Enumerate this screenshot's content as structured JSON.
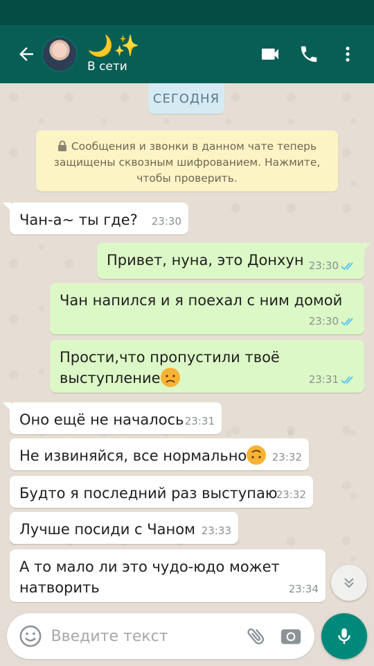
{
  "header": {
    "contact_name": "🌙✨",
    "status": "В сети"
  },
  "chat": {
    "date_label": "СЕГОДНЯ",
    "encryption_notice": "Сообщения и звонки в данном чате теперь защищены сквозным шифрованием. Нажмите, чтобы проверить.",
    "messages": [
      {
        "dir": "in",
        "text": "Чан-а~ ты где?",
        "time": "23:30"
      },
      {
        "dir": "out",
        "text": "Привет, нуна, это Донхун",
        "time": "23:30",
        "read": true
      },
      {
        "dir": "out",
        "text": "Чан напился и я поехал с ним домой",
        "time": "23:30",
        "read": true
      },
      {
        "dir": "out",
        "text": "Прости,что пропустили твоё выступление",
        "time": "23:31",
        "read": true,
        "emoji": "sad"
      },
      {
        "dir": "in",
        "text": "Оно ещё не началось",
        "time": "23:31"
      },
      {
        "dir": "in",
        "text": "Не извиняйся, все нормально",
        "time": "23:32",
        "emoji": "upside-down"
      },
      {
        "dir": "in",
        "text": "Будто я последний раз выступаю",
        "time": "23:32"
      },
      {
        "dir": "in",
        "text": "Лучше посиди с Чаном",
        "time": "23:33"
      },
      {
        "dir": "in",
        "text": "А то мало ли это чудо-юдо может натворить",
        "time": "23:34"
      }
    ]
  },
  "composer": {
    "placeholder": "Введите текст"
  },
  "colors": {
    "app_bar": "#075e54",
    "outgoing_bubble": "#dcf8c6",
    "incoming_bubble": "#ffffff",
    "read_ticks": "#4fc3f7",
    "mic_button": "#00897b"
  },
  "icons": [
    "back-arrow-icon",
    "video-call-icon",
    "phone-icon",
    "more-vert-icon",
    "lock-icon",
    "read-ticks-icon",
    "chevron-down-icon",
    "emoji-icon",
    "attach-icon",
    "camera-icon",
    "mic-icon"
  ]
}
